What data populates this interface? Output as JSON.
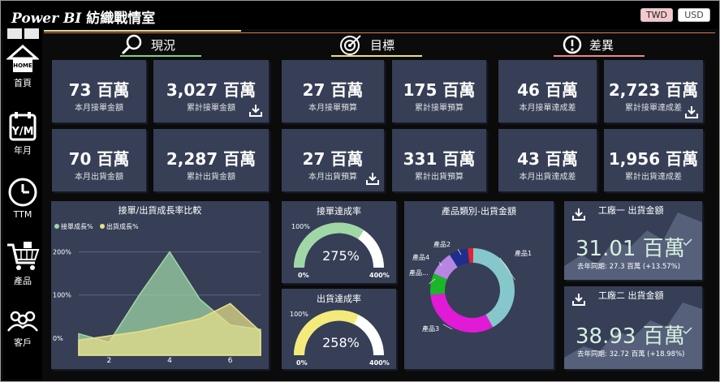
{
  "app": {
    "title_logo": "Power BI",
    "title_text": "紡織戰情室",
    "currency_twd": "TWD",
    "currency_usd": "USD"
  },
  "nav": [
    {
      "label": "首頁",
      "icon": "home-icon",
      "home_text": "HOME"
    },
    {
      "label": "年月",
      "icon": "calendar-icon",
      "cal_text": "Y/M"
    },
    {
      "label": "TTM",
      "icon": "clock-icon"
    },
    {
      "label": "產品",
      "icon": "cart-icon"
    },
    {
      "label": "客戶",
      "icon": "customers-icon"
    }
  ],
  "sections": [
    {
      "label": "現況",
      "icon": "search-icon",
      "underline": "#7fd38a"
    },
    {
      "label": "目標",
      "icon": "target-icon",
      "underline": "#e6e27a"
    },
    {
      "label": "差異",
      "icon": "alert-icon",
      "underline": "#e88a8a"
    }
  ],
  "kpis": [
    {
      "value": "73 百萬",
      "label": "本月接單金額"
    },
    {
      "value": "3,027 百萬",
      "label": "累計接單金額",
      "download": true
    },
    {
      "value": "27 百萬",
      "label": "本月接單預算"
    },
    {
      "value": "175 百萬",
      "label": "累計接單預算"
    },
    {
      "value": "46 百萬",
      "label": "本月接單達成差"
    },
    {
      "value": "2,723 百萬",
      "label": "累計接單達成差",
      "download": true
    },
    {
      "value": "70 百萬",
      "label": "本月出貨金額"
    },
    {
      "value": "2,287 百萬",
      "label": "累計出貨金額"
    },
    {
      "value": "27 百萬",
      "label": "本月出貨預算",
      "download": true
    },
    {
      "value": "331 百萬",
      "label": "累計出貨預算"
    },
    {
      "value": "43 百萬",
      "label": "本月出貨達成差"
    },
    {
      "value": "1,956 百萬",
      "label": "累計出貨達成差"
    }
  ],
  "growth_chart": {
    "title": "接單/出貨成長率比較",
    "legend": [
      "接單成長%",
      "出貨成長%"
    ],
    "colors": [
      "#9fd8a6",
      "#e9e08a"
    ],
    "chart_data": {
      "type": "area",
      "x": [
        1,
        2,
        3,
        4,
        5,
        6,
        7
      ],
      "xticks": [
        "2",
        "4",
        "6"
      ],
      "ytick_labels": [
        "200%",
        "100%",
        "0%"
      ],
      "series": [
        {
          "name": "接單成長%",
          "values": [
            0.1,
            -0.1,
            1.0,
            2.0,
            0.9,
            0.3,
            0.2
          ]
        },
        {
          "name": "出貨成長%",
          "values": [
            -0.05,
            0.05,
            0.15,
            0.3,
            0.45,
            0.8,
            0.15
          ]
        }
      ],
      "ylim": [
        -0.4,
        2.2
      ]
    }
  },
  "order_gauge": {
    "title": "接單達成率",
    "value_label": "275%",
    "min": "0%",
    "max": "400%",
    "target": "100%",
    "fraction": 0.6875,
    "color": "#9fd8a6"
  },
  "ship_gauge": {
    "title": "出貨達成率",
    "value_label": "258%",
    "min": "0%",
    "max": "400%",
    "target": "100%",
    "fraction": 0.645,
    "color": "#f3ea7a"
  },
  "donut": {
    "title": "產品類別-出貨金額",
    "chart_data": {
      "type": "pie",
      "labels": [
        "產品1",
        "產品3",
        "產品...",
        "產品4",
        "產品2",
        ""
      ],
      "values": [
        40,
        30,
        8,
        9,
        7,
        2
      ],
      "colors": [
        "#86c7cb",
        "#e11ad6",
        "#1db52a",
        "#b786e2",
        "#1e2e8c",
        "#e8202e"
      ]
    }
  },
  "factory1": {
    "title": "工廠一 出貨金額",
    "value": "31.01 百萬",
    "sub": "去年同期: 27.3 百萬 (+13.57%)"
  },
  "factory2": {
    "title": "工廠二 出貨金額",
    "value": "38.93 百萬",
    "sub": "去年同期: 32.72 百萬 (+18.98%)"
  }
}
